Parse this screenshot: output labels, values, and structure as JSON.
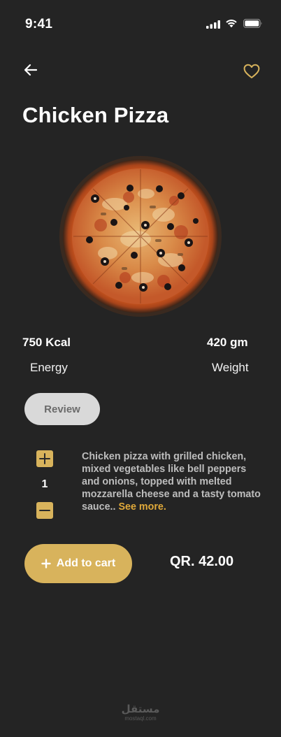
{
  "status_bar": {
    "time": "9:41"
  },
  "header": {
    "back_icon": "arrow-left-icon",
    "favorite_icon": "heart-outline-icon",
    "favorite_color": "#d8b35c"
  },
  "product": {
    "title": "Chicken Pizza",
    "image_icon": "pizza-image",
    "energy_value": "750 Kcal",
    "energy_label": "Energy",
    "weight_value": "420 gm",
    "weight_label": "Weight"
  },
  "review_label": "Review",
  "quantity": {
    "value": "1",
    "increment_icon": "plus-icon",
    "decrement_icon": "minus-icon"
  },
  "description": {
    "text": "Chicken pizza with grilled chicken, mixed vegetables like bell peppers and onions, topped with melted mozzarella cheese and a tasty tomato sauce.. ",
    "see_more": "See more."
  },
  "cart": {
    "label": "Add to cart",
    "icon": "plus-icon",
    "price": "QR. 42.00"
  },
  "watermark": {
    "arabic": "مستقل",
    "latin": "mostaql.com"
  },
  "colors": {
    "background": "#242424",
    "accent": "#d8b35c",
    "link": "#e0a93a",
    "muted_button": "#d9d9d9"
  }
}
